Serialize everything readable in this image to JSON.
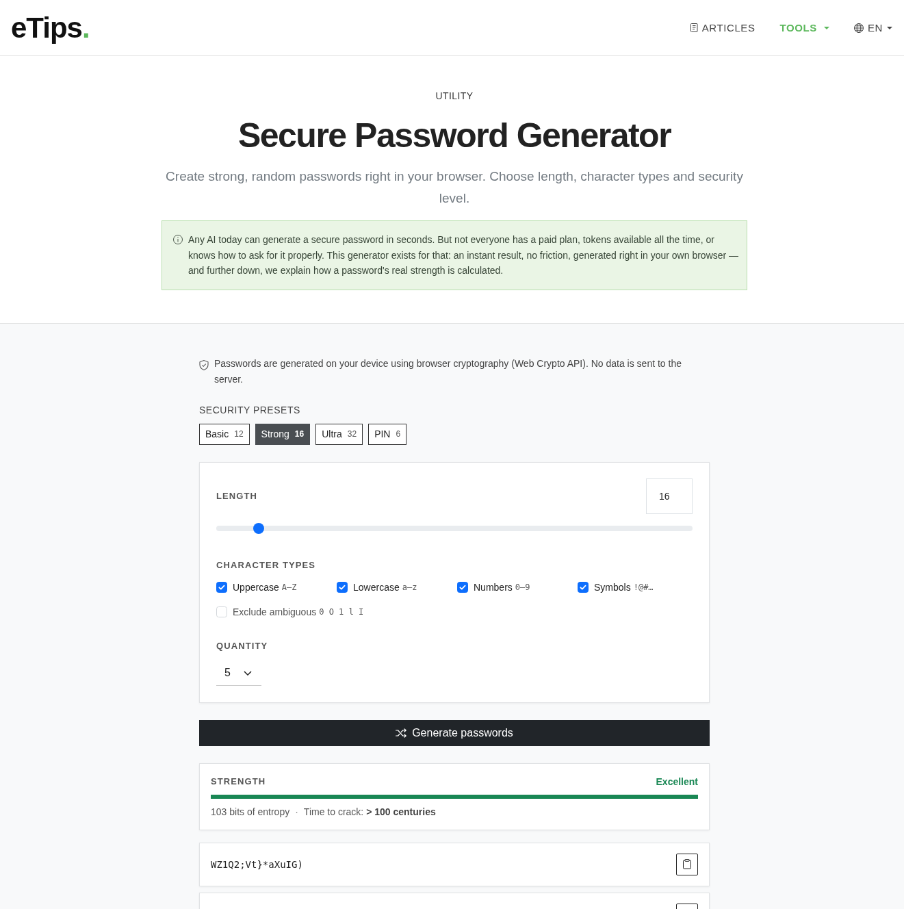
{
  "header": {
    "logo": {
      "text": "eTips",
      "dot": "."
    },
    "nav": [
      {
        "label": "ARTICLES",
        "kind": "link",
        "selected": false
      },
      {
        "label": "TOOLS",
        "kind": "menu",
        "selected": true
      },
      {
        "label": "EN",
        "kind": "language",
        "selected": false
      }
    ]
  },
  "hero": {
    "eyebrow": "UTILITY",
    "title": "Secure Password Generator",
    "subtitle": "Create strong, random passwords right in your browser. Choose length, character types and security level.",
    "notice": "Any AI today can generate a secure password in seconds. But not everyone has a paid plan, tokens available all the time, or knows how to ask for it properly. This generator exists for that: an instant result, no friction, generated right in your own browser — and further down, we explain how a password's real strength is calculated."
  },
  "privacy_note": "Passwords are generated on your device using browser cryptography (Web Crypto API). No data is sent to the server.",
  "presets": {
    "label": "SECURITY PRESETS",
    "items": [
      {
        "label": "Basic",
        "length": "12",
        "selected": false
      },
      {
        "label": "Strong",
        "length": "16",
        "selected": true
      },
      {
        "label": "Ultra",
        "length": "32",
        "selected": false
      },
      {
        "label": "PIN",
        "length": "6",
        "selected": false
      }
    ]
  },
  "settings": {
    "length": {
      "label": "LENGTH",
      "value": "16",
      "level": 0.08
    },
    "character_types": {
      "label": "CHARACTER TYPES",
      "options": [
        {
          "label": "Uppercase",
          "hint": "A–Z",
          "checked": true
        },
        {
          "label": "Lowercase",
          "hint": "a–z",
          "checked": true
        },
        {
          "label": "Numbers",
          "hint": "0–9",
          "checked": true
        },
        {
          "label": "Symbols",
          "hint": "!@#…",
          "checked": true
        }
      ],
      "exclude_ambiguous": {
        "label": "Exclude ambiguous",
        "hint": "0 O 1 l I",
        "checked": false
      }
    },
    "quantity": {
      "label": "QUANTITY",
      "value": "5"
    }
  },
  "generate_button": "Generate passwords",
  "strength": {
    "label": "STRENGTH",
    "rating": "Excellent",
    "level": 1,
    "entropy": "103 bits of entropy",
    "separator": "·",
    "crack_time": "Time to crack: **> 100 centuries**"
  },
  "results": {
    "passwords": [
      {
        "value": "WZ1Q2;Vt}*aXuIG)"
      }
    ],
    "next_row_cut_off": true
  }
}
